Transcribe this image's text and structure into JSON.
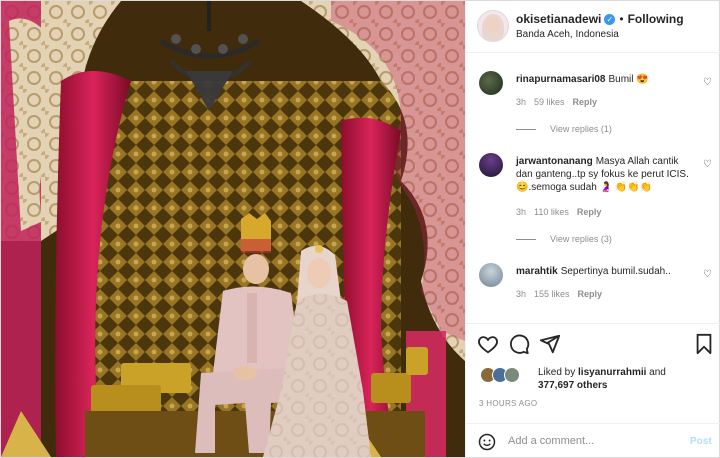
{
  "header": {
    "username": "okisetianadewi",
    "separator": "•",
    "follow_label": "Following",
    "location": "Banda Aceh, Indonesia"
  },
  "comments": [
    {
      "username": "rinapurnamasari08",
      "text": "Bumil 😍",
      "time": "3h",
      "likes": "59 likes",
      "reply_label": "Reply",
      "view_replies": "View replies (1)"
    },
    {
      "username": "jarwantonanang",
      "text": "Masya Allah cantik dan ganteng..tp sy fokus ke perut ICIS.😊.semoga sudah 🤰 👏👏👏",
      "time": "3h",
      "likes": "110 likes",
      "reply_label": "Reply",
      "view_replies": "View replies (3)"
    },
    {
      "username": "marahtik",
      "text": "Sepertinya bumil.sudah..",
      "time": "3h",
      "likes": "155 likes",
      "reply_label": "Reply"
    }
  ],
  "likes": {
    "prefix": "Liked by",
    "user": "lisyanurrahmii",
    "conjunction": "and",
    "others": "377,697 others"
  },
  "timestamp": "3 HOURS AGO",
  "add_comment": {
    "placeholder": "Add a comment...",
    "post_label": "Post"
  },
  "icons": {
    "heart": "heart-icon",
    "comment": "comment-icon",
    "share": "share-icon",
    "save": "bookmark-icon",
    "emoji": "emoji-icon",
    "verified": "verified-badge-icon"
  },
  "colors": {
    "link_blue": "#3897f0",
    "post_disabled": "#b2dffc",
    "muted_text": "#8e8e8e",
    "border": "#efefef"
  }
}
